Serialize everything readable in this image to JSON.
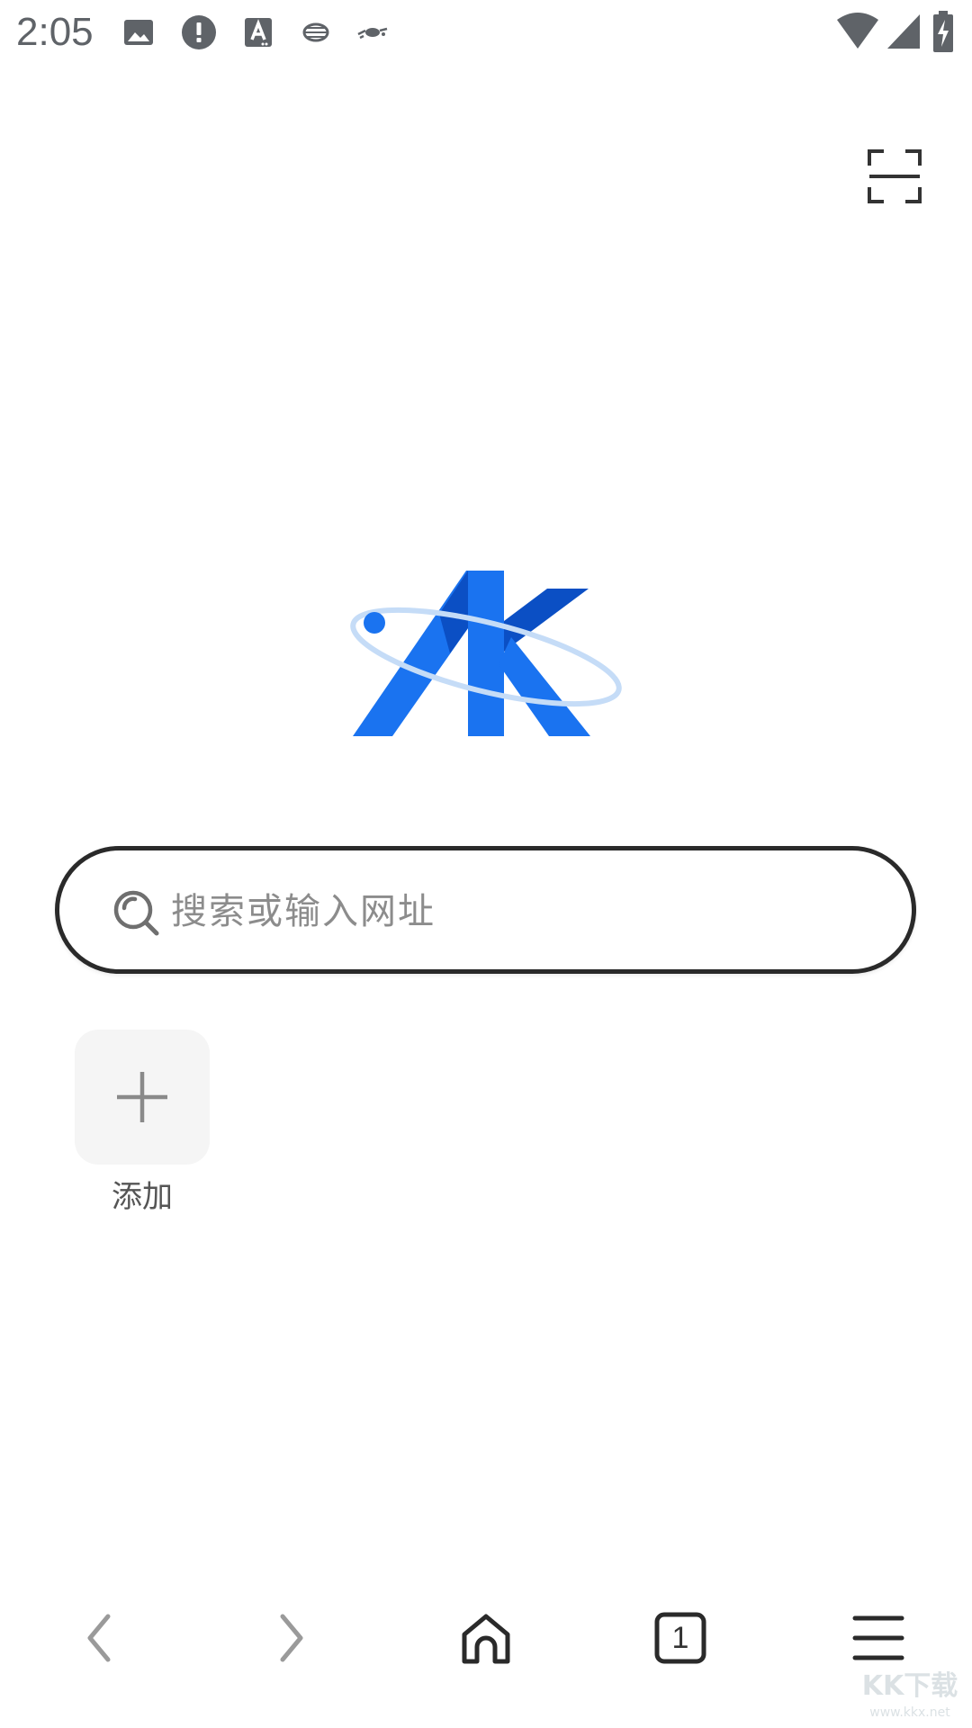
{
  "status_bar": {
    "time": "2:05",
    "left_icons": [
      "image-icon",
      "alert-icon",
      "a-accessibility-icon",
      "globe-icon",
      "satellite-icon"
    ],
    "right_icons": [
      "wifi-icon",
      "signal-icon",
      "battery-charging-icon"
    ]
  },
  "header": {
    "scan_icon": "scan-icon"
  },
  "logo": {
    "text": "AK",
    "colors": {
      "primary": "#1a73f0",
      "dark": "#0b4fc4",
      "orbit": "#c5dcf7"
    }
  },
  "search": {
    "placeholder": "搜索或输入网址",
    "icon": "search-icon"
  },
  "shortcuts": [
    {
      "label": "添加",
      "icon": "plus-icon"
    }
  ],
  "bottom_nav": {
    "items": [
      {
        "name": "back",
        "icon": "chevron-left-icon"
      },
      {
        "name": "forward",
        "icon": "chevron-right-icon"
      },
      {
        "name": "home",
        "icon": "home-icon"
      },
      {
        "name": "tabs",
        "icon": "tabs-icon",
        "count": "1"
      },
      {
        "name": "menu",
        "icon": "menu-icon"
      }
    ]
  },
  "watermark": {
    "text": "KK下载",
    "sub": "www.kkx.net"
  }
}
